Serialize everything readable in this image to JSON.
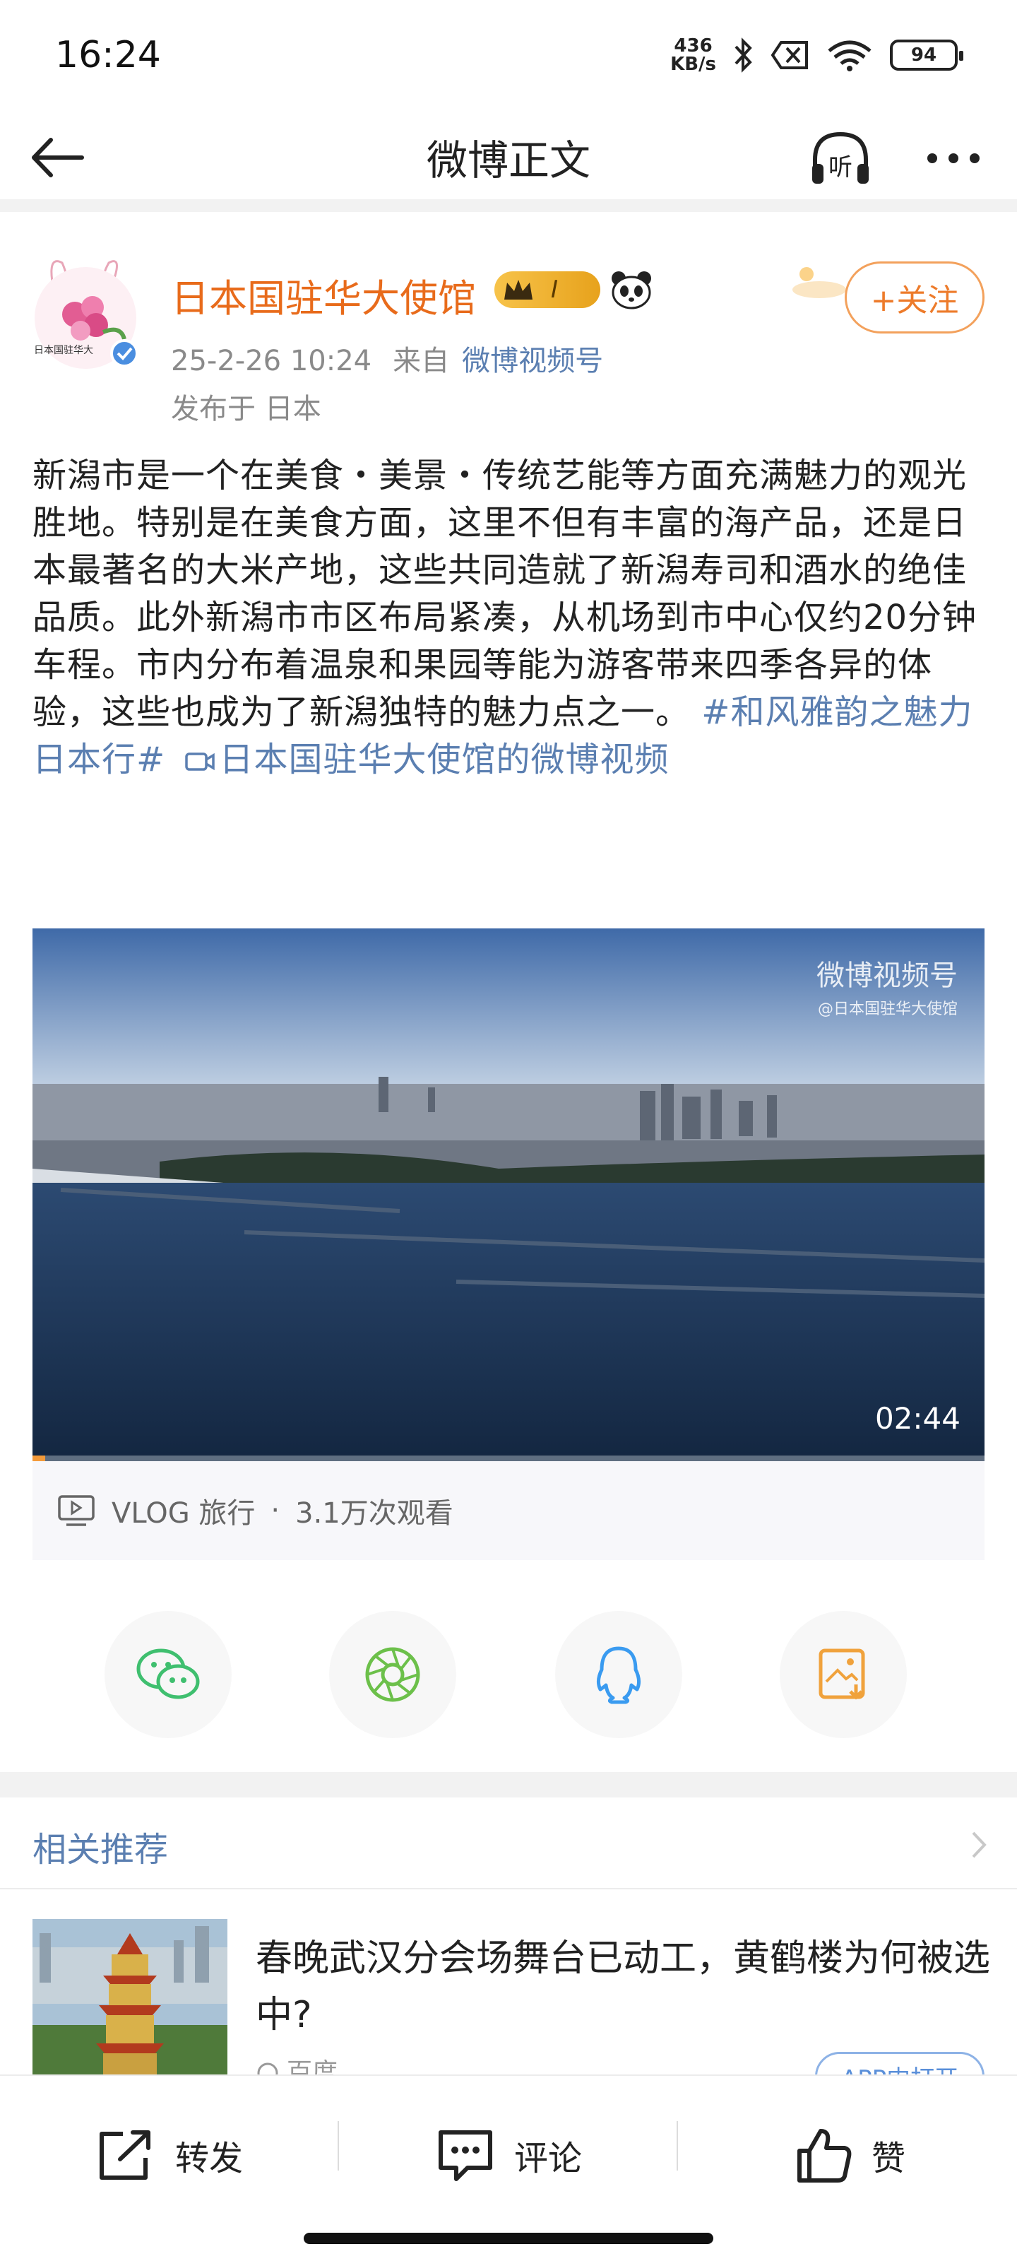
{
  "status_bar": {
    "time": "16:24",
    "net_speed_value": "436",
    "net_speed_unit": "KB/s",
    "battery": "94",
    "icons": [
      "bluetooth-icon",
      "no-sim-icon",
      "wifi-icon",
      "battery-icon"
    ]
  },
  "nav": {
    "title": "微博正文",
    "icons": [
      "back-arrow-icon",
      "listen-headphone-icon",
      "more-dots-icon"
    ]
  },
  "author": {
    "name": "日本国驻华大使馆",
    "badge_level": "I",
    "avatar_text": "日本国驻华大",
    "timestamp": "25-2-26 10:24",
    "from_label": "来自",
    "source": "微博视频号",
    "location": "发布于 日本",
    "follow_label": "+关注"
  },
  "post": {
    "text": "新潟市是一个在美食・美景・传统艺能等方面充满魅力的观光胜地。特别是在美食方面，这里不但有丰富的海产品，还是日本最著名的大米产地，这些共同造就了新潟寿司和酒水的绝佳品质。此外新潟市市区布局紧凑，从机场到市中心仅约20分钟车程。市内分布着温泉和果园等能为游客带来四季各异的体验，这些也成为了新潟独特的魅力点之一。",
    "hashtag": "#和风雅韵之魅力日本行#",
    "video_link": "日本国驻华大使馆的微博视频"
  },
  "video": {
    "duration": "02:44",
    "watermark": "微博视频号",
    "watermark_sub": "@日本国驻华大使馆",
    "progress": 0.013,
    "category": "VLOG 旅行",
    "separator": "·",
    "views": "3.1万次观看"
  },
  "share": {
    "buttons": [
      "wechat-icon",
      "moments-icon",
      "qq-icon",
      "save-image-icon"
    ],
    "colors": {
      "wechat": "#3fbf6f",
      "moments": "#6cc04a",
      "qq": "#3a9bf0",
      "save": "#f0a23c"
    }
  },
  "related": {
    "title": "相关推荐",
    "item_headline": "春晚武汉分会场舞台已动工，黄鹤楼为何被选中?",
    "item_source": "百度",
    "item_button": "APP内打开"
  },
  "bottom_bar": {
    "repost": "转发",
    "comment": "评论",
    "like": "赞"
  },
  "colors": {
    "accent_orange": "#e86b1b",
    "link_blue": "#5b7fb1"
  }
}
